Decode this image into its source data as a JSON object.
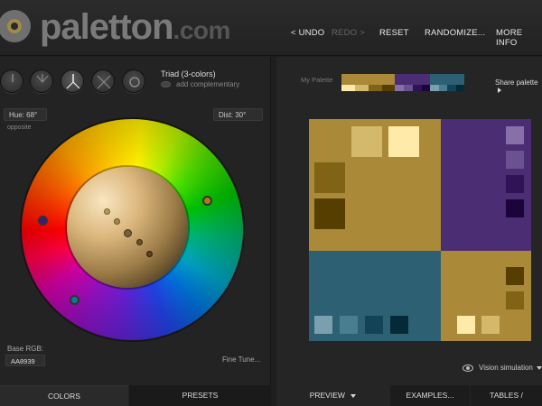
{
  "header": {
    "logo_text": "paletton",
    "logo_domain": ".com",
    "nav": {
      "undo": "< UNDO",
      "redo": "REDO >",
      "reset": "RESET",
      "randomize": "RANDOMIZE...",
      "more_info": "MORE INFO"
    }
  },
  "left_panel": {
    "scheme_title": "Triad (3-colors)",
    "add_complementary": "add complementary",
    "hue_label": "Hue: 68°",
    "dist_label": "Dist: 30°",
    "opposite_label": "opposite",
    "base_rgb_label": "Base RGB:",
    "base_rgb_value": "AA8939",
    "fine_tune": "Fine Tune...",
    "tabs": {
      "colors": "COLORS",
      "presets": "PRESETS"
    }
  },
  "right_panel": {
    "my_palette_label": "My Palette",
    "share_palette": "Share palette",
    "vision_simulation": "Vision simulation",
    "tabs": {
      "preview": "PREVIEW",
      "examples": "EXAMPLES...",
      "tables": "TABLES / EXPORT..."
    }
  },
  "colors": {
    "primary": [
      "#AA8939",
      "#D4B96C",
      "#FFEAAA",
      "#806315",
      "#553E00"
    ],
    "secondary_a": [
      "#4B2D73",
      "#8770A7",
      "#6A5291",
      "#301356",
      "#1A0439"
    ],
    "secondary_b": [
      "#2D6073",
      "#7A9FAE",
      "#497E92",
      "#134356",
      "#042A39"
    ],
    "tertiary": [
      "#AA8939",
      "#806315",
      "#553E00",
      "#D4B96C",
      "#FFEAAA"
    ]
  },
  "icons": {
    "scheme_mono": "mono-scheme-icon",
    "scheme_adjacent": "adjacent-scheme-icon",
    "scheme_triad": "triad-scheme-icon",
    "scheme_tetrad": "tetrad-scheme-icon",
    "scheme_free": "free-style-icon",
    "eye": "eye-icon"
  }
}
